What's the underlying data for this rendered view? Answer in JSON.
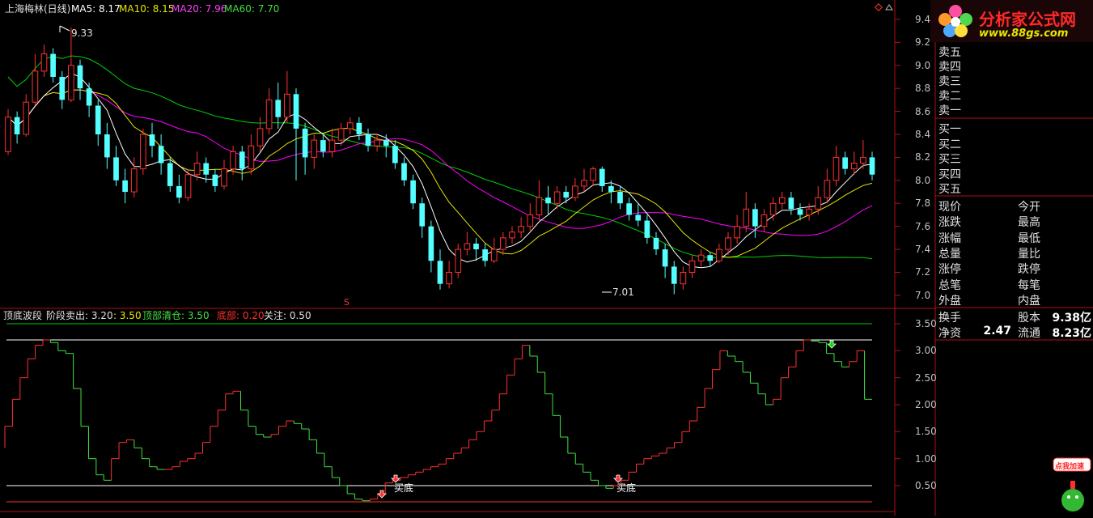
{
  "header": {
    "stock_name": "上海梅林(日线)",
    "ma5_label": "MA5: 8.17",
    "ma10_label": "MA10: 8.15",
    "ma20_label": "MA20: 7.96",
    "ma60_label": "MA60: 7.70"
  },
  "colors": {
    "up": "#ff3030",
    "down": "#54ffff",
    "ma5": "#ffffff",
    "ma10": "#e6e600",
    "ma20": "#ff00ff",
    "ma60": "#00d000",
    "frame": "#b01010"
  },
  "price_annotations": {
    "high": "9.33",
    "low": "7.01",
    "marker": "S"
  },
  "price_axis": [
    "9.4",
    "9.2",
    "9.0",
    "8.8",
    "8.6",
    "8.4",
    "8.2",
    "8.0",
    "7.8",
    "7.6",
    "7.4",
    "7.2",
    "7.0"
  ],
  "indicator_header": {
    "name": "顶底波段",
    "stage_sell": "阶段卖出: 3.20",
    "value_350": ": 3.50",
    "top_clear": "顶部清仓: 3.50",
    "bottom": "底部: 0.20",
    "watch": "关注: 0.50"
  },
  "indicator_axis": [
    "3.50",
    "3.00",
    "2.50",
    "2.00",
    "1.50",
    "1.00",
    "0.50"
  ],
  "indicator_labels": {
    "buy_bottom_1": "买底",
    "buy_bottom_2": "买底"
  },
  "order_book": {
    "sell": [
      "卖五",
      "卖四",
      "卖三",
      "卖二",
      "卖一"
    ],
    "buy": [
      "买一",
      "买二",
      "买三",
      "买四",
      "买五"
    ]
  },
  "quote_fields": {
    "left": [
      "现价",
      "涨跌",
      "涨幅",
      "总量",
      "涨停",
      "总笔",
      "外盘"
    ],
    "right": [
      "今开",
      "最高",
      "最低",
      "量比",
      "跌停",
      "每笔",
      "内盘"
    ]
  },
  "stats": {
    "turnover_label": "换手",
    "share_capital_label": "股本",
    "share_capital_value": "9.38亿",
    "net_assets_label": "净资",
    "net_assets_value": "2.47",
    "float_label": "流通",
    "float_value": "8.23亿"
  },
  "logo": {
    "title": "分析家公式网",
    "url": "www.88gs.com"
  },
  "promo": {
    "label": "点我加速"
  },
  "chart_data": [
    {
      "type": "candlestick",
      "title": "",
      "ylim": [
        6.95,
        9.47
      ],
      "highlights": {
        "high": 9.33,
        "low": 7.01
      },
      "candles": [
        [
          8.25,
          8.55,
          8.62,
          8.22
        ],
        [
          8.55,
          8.4,
          8.6,
          8.32
        ],
        [
          8.4,
          8.68,
          8.75,
          8.38
        ],
        [
          8.68,
          8.95,
          9.1,
          8.65
        ],
        [
          8.95,
          9.1,
          9.18,
          8.9
        ],
        [
          9.1,
          8.9,
          9.15,
          8.85
        ],
        [
          8.9,
          8.7,
          8.95,
          8.62
        ],
        [
          8.7,
          9.0,
          9.33,
          8.68
        ],
        [
          9.0,
          8.8,
          9.05,
          8.7
        ],
        [
          8.8,
          8.65,
          8.85,
          8.55
        ],
        [
          8.65,
          8.4,
          8.7,
          8.3
        ],
        [
          8.4,
          8.2,
          8.5,
          8.1
        ],
        [
          8.2,
          8.0,
          8.3,
          7.95
        ],
        [
          8.0,
          7.9,
          8.1,
          7.8
        ],
        [
          7.9,
          8.1,
          8.2,
          7.85
        ],
        [
          8.1,
          8.4,
          8.45,
          8.05
        ],
        [
          8.4,
          8.3,
          8.5,
          8.2
        ],
        [
          8.3,
          8.15,
          8.4,
          8.05
        ],
        [
          8.15,
          7.95,
          8.2,
          7.9
        ],
        [
          7.95,
          7.85,
          8.05,
          7.8
        ],
        [
          7.85,
          8.05,
          8.1,
          7.82
        ],
        [
          8.05,
          8.15,
          8.25,
          8.0
        ],
        [
          8.15,
          8.05,
          8.2,
          7.98
        ],
        [
          8.05,
          7.95,
          8.1,
          7.9
        ],
        [
          7.95,
          8.1,
          8.18,
          7.92
        ],
        [
          8.1,
          8.25,
          8.3,
          8.05
        ],
        [
          8.25,
          8.1,
          8.3,
          8.0
        ],
        [
          8.1,
          8.3,
          8.4,
          8.05
        ],
        [
          8.3,
          8.45,
          8.55,
          8.25
        ],
        [
          8.45,
          8.7,
          8.8,
          8.4
        ],
        [
          8.7,
          8.55,
          8.85,
          8.45
        ],
        [
          8.55,
          8.75,
          8.95,
          8.5
        ],
        [
          8.75,
          8.45,
          8.8,
          8.0
        ],
        [
          8.45,
          8.2,
          8.5,
          8.05
        ],
        [
          8.2,
          8.35,
          8.4,
          8.1
        ],
        [
          8.35,
          8.25,
          8.4,
          8.2
        ],
        [
          8.25,
          8.35,
          8.45,
          8.2
        ],
        [
          8.35,
          8.45,
          8.5,
          8.3
        ],
        [
          8.45,
          8.5,
          8.55,
          8.4
        ],
        [
          8.5,
          8.4,
          8.55,
          8.35
        ],
        [
          8.4,
          8.3,
          8.45,
          8.25
        ],
        [
          8.3,
          8.35,
          8.4,
          8.25
        ],
        [
          8.35,
          8.3,
          8.4,
          8.2
        ],
        [
          8.3,
          8.15,
          8.35,
          8.1
        ],
        [
          8.15,
          8.0,
          8.2,
          7.95
        ],
        [
          8.0,
          7.8,
          8.05,
          7.75
        ],
        [
          7.8,
          7.6,
          7.85,
          7.5
        ],
        [
          7.6,
          7.3,
          7.65,
          7.2
        ],
        [
          7.3,
          7.1,
          7.4,
          7.05
        ],
        [
          7.1,
          7.2,
          7.3,
          7.06
        ],
        [
          7.2,
          7.4,
          7.45,
          7.15
        ],
        [
          7.4,
          7.45,
          7.55,
          7.35
        ],
        [
          7.45,
          7.4,
          7.5,
          7.3
        ],
        [
          7.4,
          7.3,
          7.45,
          7.25
        ],
        [
          7.3,
          7.4,
          7.5,
          7.28
        ],
        [
          7.4,
          7.5,
          7.55,
          7.35
        ],
        [
          7.5,
          7.55,
          7.6,
          7.45
        ],
        [
          7.55,
          7.6,
          7.68,
          7.5
        ],
        [
          7.6,
          7.7,
          7.8,
          7.55
        ],
        [
          7.7,
          7.85,
          8.0,
          7.65
        ],
        [
          7.85,
          7.8,
          7.95,
          7.7
        ],
        [
          7.8,
          7.9,
          7.95,
          7.75
        ],
        [
          7.9,
          7.85,
          7.95,
          7.8
        ],
        [
          7.85,
          7.95,
          8.02,
          7.82
        ],
        [
          7.95,
          8.0,
          8.1,
          7.9
        ],
        [
          8.0,
          8.1,
          8.12,
          7.95
        ],
        [
          8.1,
          7.95,
          8.12,
          7.9
        ],
        [
          7.95,
          7.9,
          8.0,
          7.8
        ],
        [
          7.9,
          7.8,
          7.95,
          7.75
        ],
        [
          7.8,
          7.7,
          7.85,
          7.65
        ],
        [
          7.7,
          7.65,
          7.8,
          7.6
        ],
        [
          7.65,
          7.5,
          7.7,
          7.45
        ],
        [
          7.5,
          7.4,
          7.55,
          7.35
        ],
        [
          7.4,
          7.25,
          7.45,
          7.15
        ],
        [
          7.25,
          7.1,
          7.3,
          7.01
        ],
        [
          7.1,
          7.2,
          7.25,
          7.05
        ],
        [
          7.2,
          7.3,
          7.35,
          7.15
        ],
        [
          7.3,
          7.35,
          7.4,
          7.25
        ],
        [
          7.35,
          7.3,
          7.38,
          7.25
        ],
        [
          7.3,
          7.4,
          7.45,
          7.28
        ],
        [
          7.4,
          7.5,
          7.55,
          7.35
        ],
        [
          7.5,
          7.6,
          7.7,
          7.45
        ],
        [
          7.6,
          7.75,
          7.9,
          7.55
        ],
        [
          7.75,
          7.6,
          7.8,
          7.5
        ],
        [
          7.6,
          7.7,
          7.75,
          7.55
        ],
        [
          7.7,
          7.8,
          7.85,
          7.65
        ],
        [
          7.8,
          7.85,
          7.9,
          7.75
        ],
        [
          7.85,
          7.75,
          7.9,
          7.7
        ],
        [
          7.75,
          7.7,
          7.8,
          7.65
        ],
        [
          7.7,
          7.75,
          7.8,
          7.65
        ],
        [
          7.75,
          7.85,
          7.95,
          7.7
        ],
        [
          7.85,
          8.0,
          8.1,
          7.8
        ],
        [
          8.0,
          8.2,
          8.3,
          7.95
        ],
        [
          8.2,
          8.1,
          8.25,
          8.05
        ],
        [
          8.1,
          8.15,
          8.25,
          8.05
        ],
        [
          8.15,
          8.2,
          8.35,
          8.1
        ],
        [
          8.2,
          8.05,
          8.25,
          8.0
        ]
      ],
      "series": [
        {
          "name": "MA5"
        },
        {
          "name": "MA10"
        },
        {
          "name": "MA20"
        },
        {
          "name": "MA60"
        }
      ]
    },
    {
      "type": "line",
      "title": "",
      "ylim": [
        0.05,
        3.65
      ],
      "levels": [
        3.5,
        3.2,
        0.5,
        0.2
      ],
      "values": [
        1.2,
        1.6,
        2.1,
        2.5,
        2.85,
        3.1,
        3.2,
        3.15,
        3.0,
        2.95,
        2.3,
        1.6,
        1.0,
        0.7,
        0.6,
        1.0,
        1.3,
        1.35,
        1.2,
        1.0,
        0.85,
        0.8,
        0.8,
        0.85,
        0.95,
        1.0,
        1.1,
        1.3,
        1.6,
        1.9,
        2.2,
        2.25,
        1.9,
        1.6,
        1.45,
        1.4,
        1.45,
        1.6,
        1.7,
        1.65,
        1.55,
        1.35,
        1.1,
        0.85,
        0.65,
        0.5,
        0.35,
        0.25,
        0.22,
        0.25,
        0.35,
        0.55,
        0.6,
        0.65,
        0.7,
        0.75,
        0.8,
        0.85,
        0.9,
        1.0,
        1.1,
        1.2,
        1.35,
        1.5,
        1.7,
        1.9,
        2.2,
        2.55,
        2.85,
        3.1,
        2.9,
        2.6,
        2.2,
        1.8,
        1.4,
        1.1,
        0.9,
        0.75,
        0.6,
        0.5,
        0.45,
        0.5,
        0.6,
        0.75,
        0.9,
        1.0,
        1.05,
        1.1,
        1.2,
        1.3,
        1.5,
        1.7,
        1.95,
        2.3,
        2.65,
        3.0,
        2.9,
        2.8,
        2.6,
        2.4,
        2.2,
        2.0,
        2.1,
        2.5,
        2.7,
        3.0,
        3.2,
        3.18,
        3.15,
        2.95,
        2.8,
        2.7,
        2.8,
        3.0,
        2.1
      ]
    }
  ]
}
